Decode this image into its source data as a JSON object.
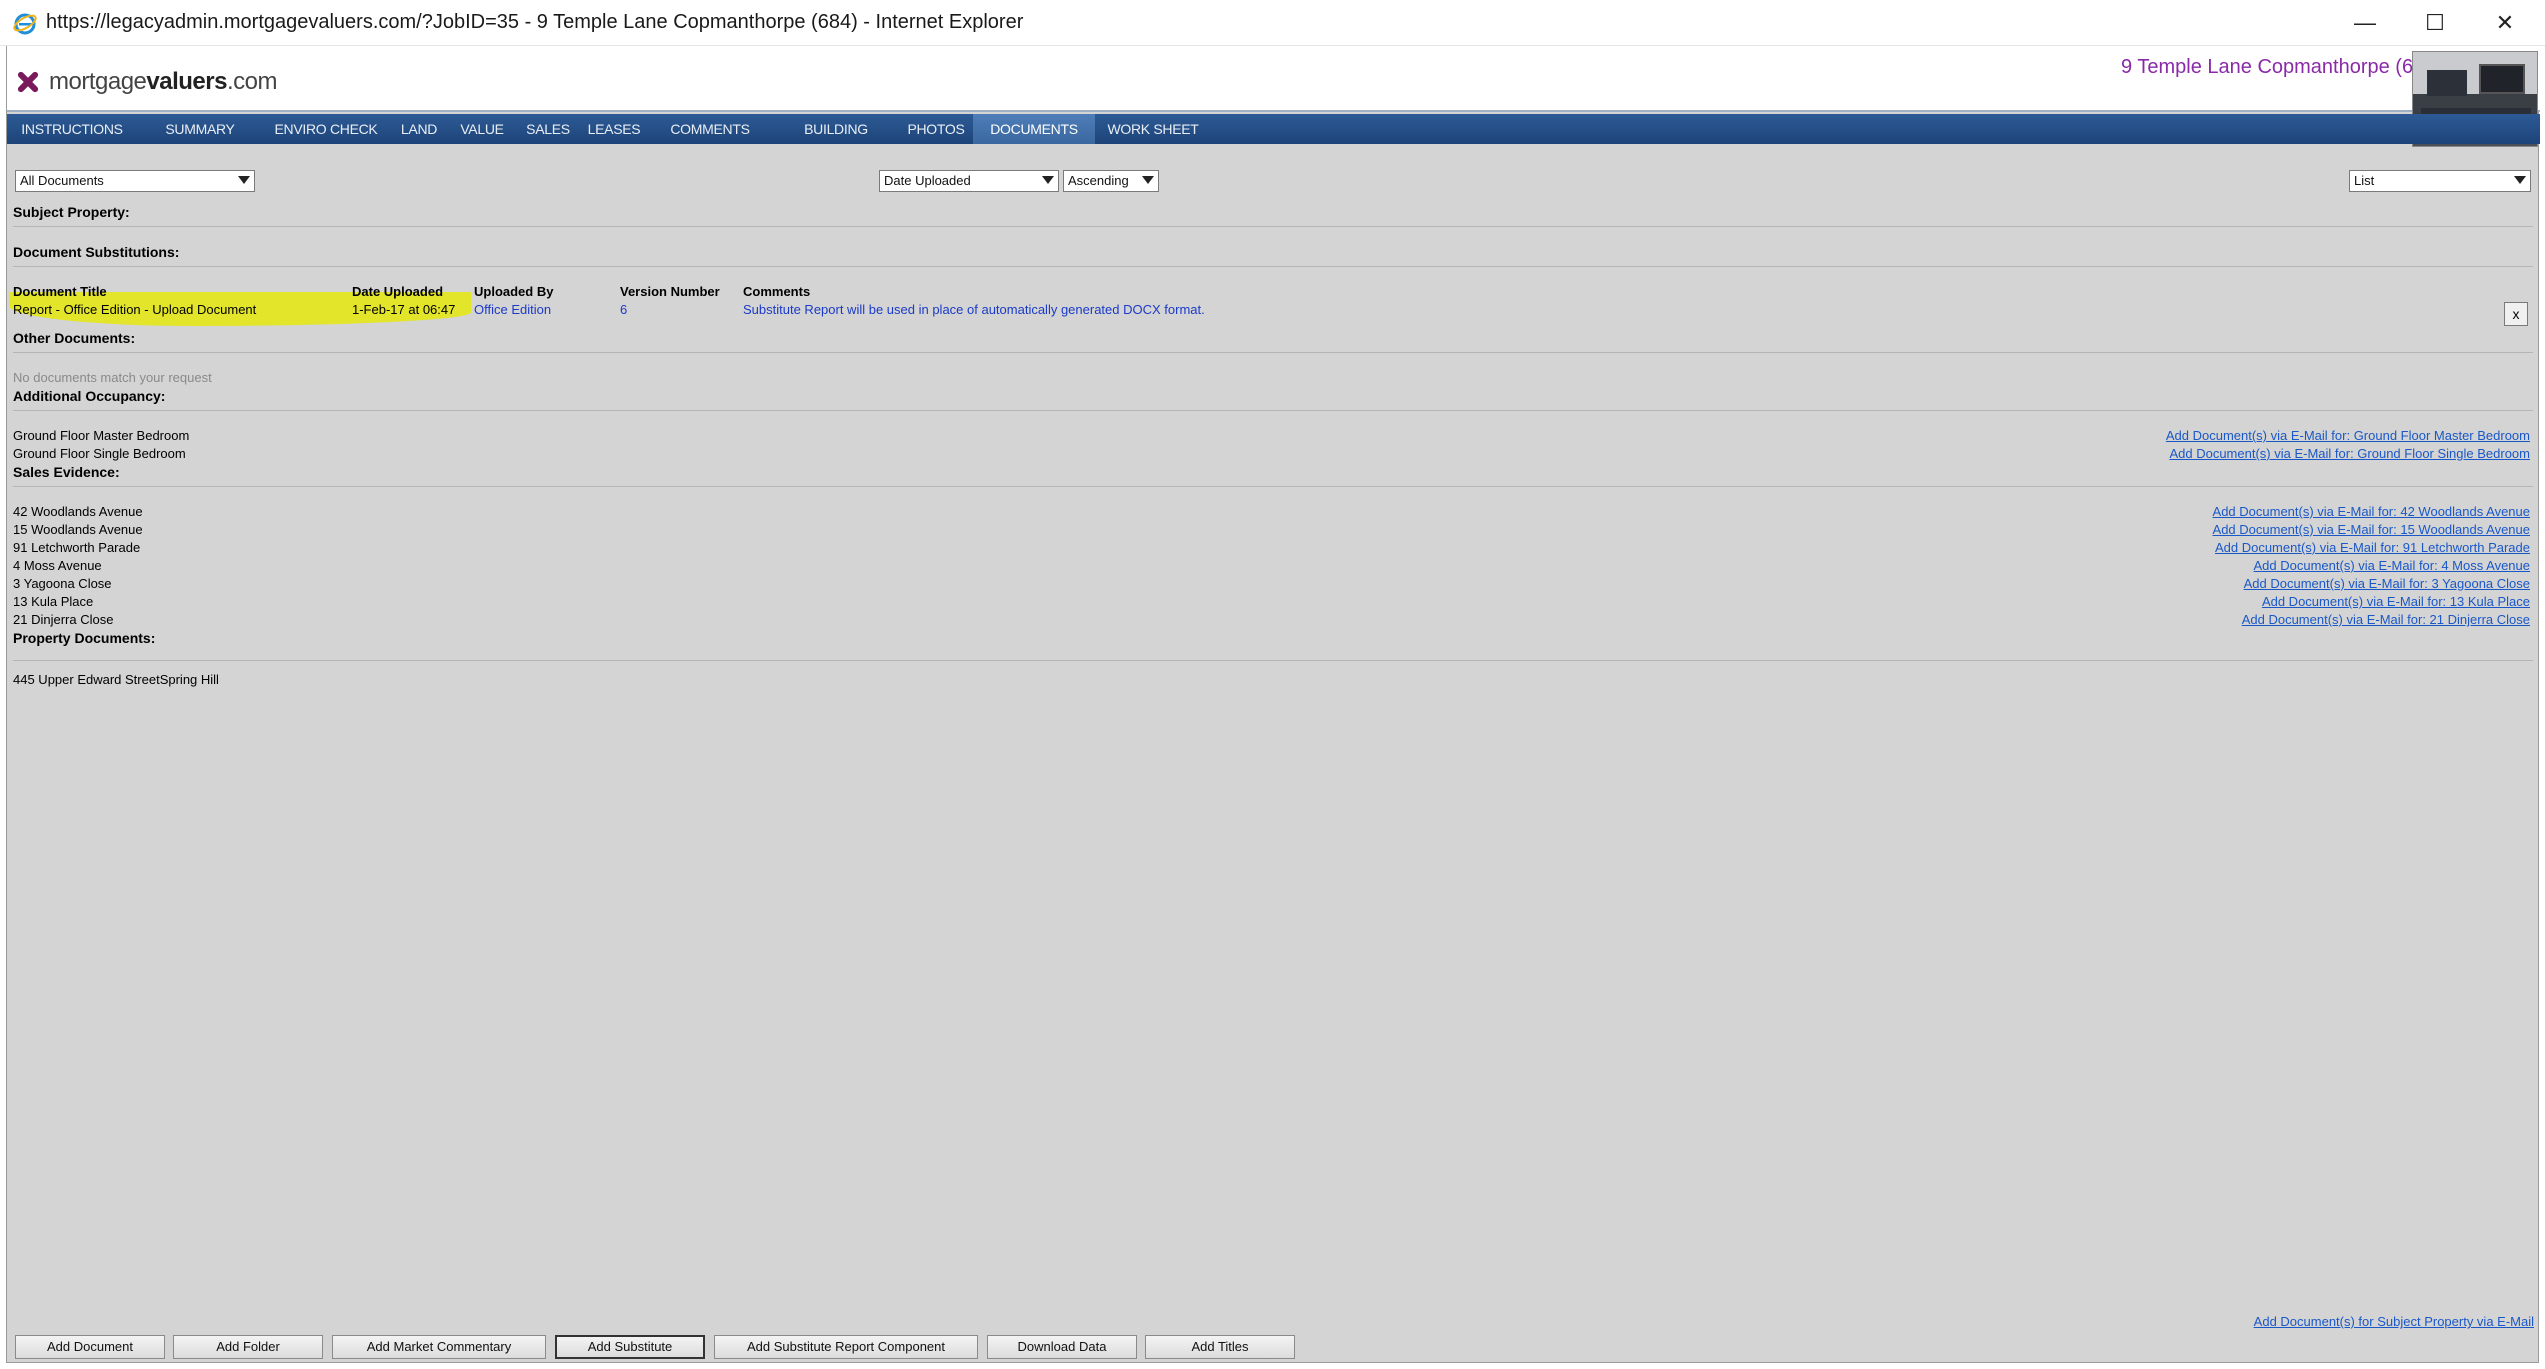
{
  "window": {
    "title": "https://legacyadmin.mortgagevaluers.com/?JobID=35 - 9 Temple Lane  Copmanthorpe  (684) - Internet Explorer",
    "minimize": "—",
    "maximize": "☐",
    "close": "✕"
  },
  "header": {
    "logo_prefix": "mortgage",
    "logo_bold": "valuers",
    "logo_suffix": ".com",
    "property_title": "9 Temple Lane  Copmanthorpe  (684)"
  },
  "nav": {
    "tabs": [
      {
        "label": "INSTRUCTIONS",
        "active": false
      },
      {
        "label": "SUMMARY",
        "active": false
      },
      {
        "label": "ENVIRO CHECK",
        "active": false
      },
      {
        "label": "LAND",
        "active": false
      },
      {
        "label": "VALUE",
        "active": false
      },
      {
        "label": "SALES",
        "active": false
      },
      {
        "label": "LEASES",
        "active": false
      },
      {
        "label": "COMMENTS",
        "active": false
      },
      {
        "label": "BUILDING",
        "active": false
      },
      {
        "label": "PHOTOS",
        "active": false
      },
      {
        "label": "DOCUMENTS",
        "active": true
      },
      {
        "label": "WORK SHEET",
        "active": false
      }
    ]
  },
  "filters": {
    "document_filter": "All Documents",
    "sort_field": "Date Uploaded",
    "sort_order": "Ascending",
    "view_mode": "List"
  },
  "sections": {
    "subject_property": "Subject Property:",
    "document_substitutions": "Document Substitutions:",
    "other_documents": "Other Documents:",
    "additional_occupancy": "Additional Occupancy:",
    "sales_evidence": "Sales Evidence:",
    "property_documents": "Property Documents:"
  },
  "substitutions_table": {
    "headers": {
      "title": "Document Title",
      "date": "Date Uploaded",
      "uploaded_by": "Uploaded By",
      "version": "Version Number",
      "comments": "Comments"
    },
    "row": {
      "title": "Report - Office Edition - Upload Document",
      "date": "1-Feb-17 at 06:47",
      "uploaded_by": "Office Edition",
      "version": "6",
      "comments": "Substitute Report will be used in place of automatically generated DOCX format.",
      "remove": "x"
    }
  },
  "other_documents_empty": "No documents match your request",
  "additional_occupancy": [
    {
      "name": "Ground Floor Master Bedroom",
      "link": "Add Document(s) via E-Mail for: Ground Floor Master Bedroom"
    },
    {
      "name": "Ground Floor Single Bedroom",
      "link": "Add Document(s) via E-Mail for: Ground Floor Single Bedroom"
    }
  ],
  "sales_evidence": [
    {
      "name": "42 Woodlands Avenue",
      "link": "Add Document(s) via E-Mail for: 42 Woodlands Avenue"
    },
    {
      "name": "15 Woodlands Avenue",
      "link": "Add Document(s) via E-Mail for: 15 Woodlands Avenue"
    },
    {
      "name": "91 Letchworth Parade",
      "link": "Add Document(s) via E-Mail for: 91 Letchworth Parade"
    },
    {
      "name": "4 Moss Avenue",
      "link": "Add Document(s) via E-Mail for: 4 Moss Avenue"
    },
    {
      "name": "3 Yagoona Close",
      "link": "Add Document(s) via E-Mail for: 3 Yagoona Close"
    },
    {
      "name": "13 Kula Place",
      "link": "Add Document(s) via E-Mail for: 13 Kula Place"
    },
    {
      "name": "21 Dinjerra Close",
      "link": "Add Document(s) via E-Mail for: 21 Dinjerra Close"
    }
  ],
  "property_documents": [
    "445 Upper Edward StreetSpring Hill"
  ],
  "footer": {
    "email_link": "Add Document(s) for Subject Property via E-Mail",
    "buttons": [
      "Add Document",
      "Add Folder",
      "Add Market Commentary",
      "Add Substitute",
      "Add Substitute Report Component",
      "Download Data",
      "Add Titles"
    ]
  }
}
